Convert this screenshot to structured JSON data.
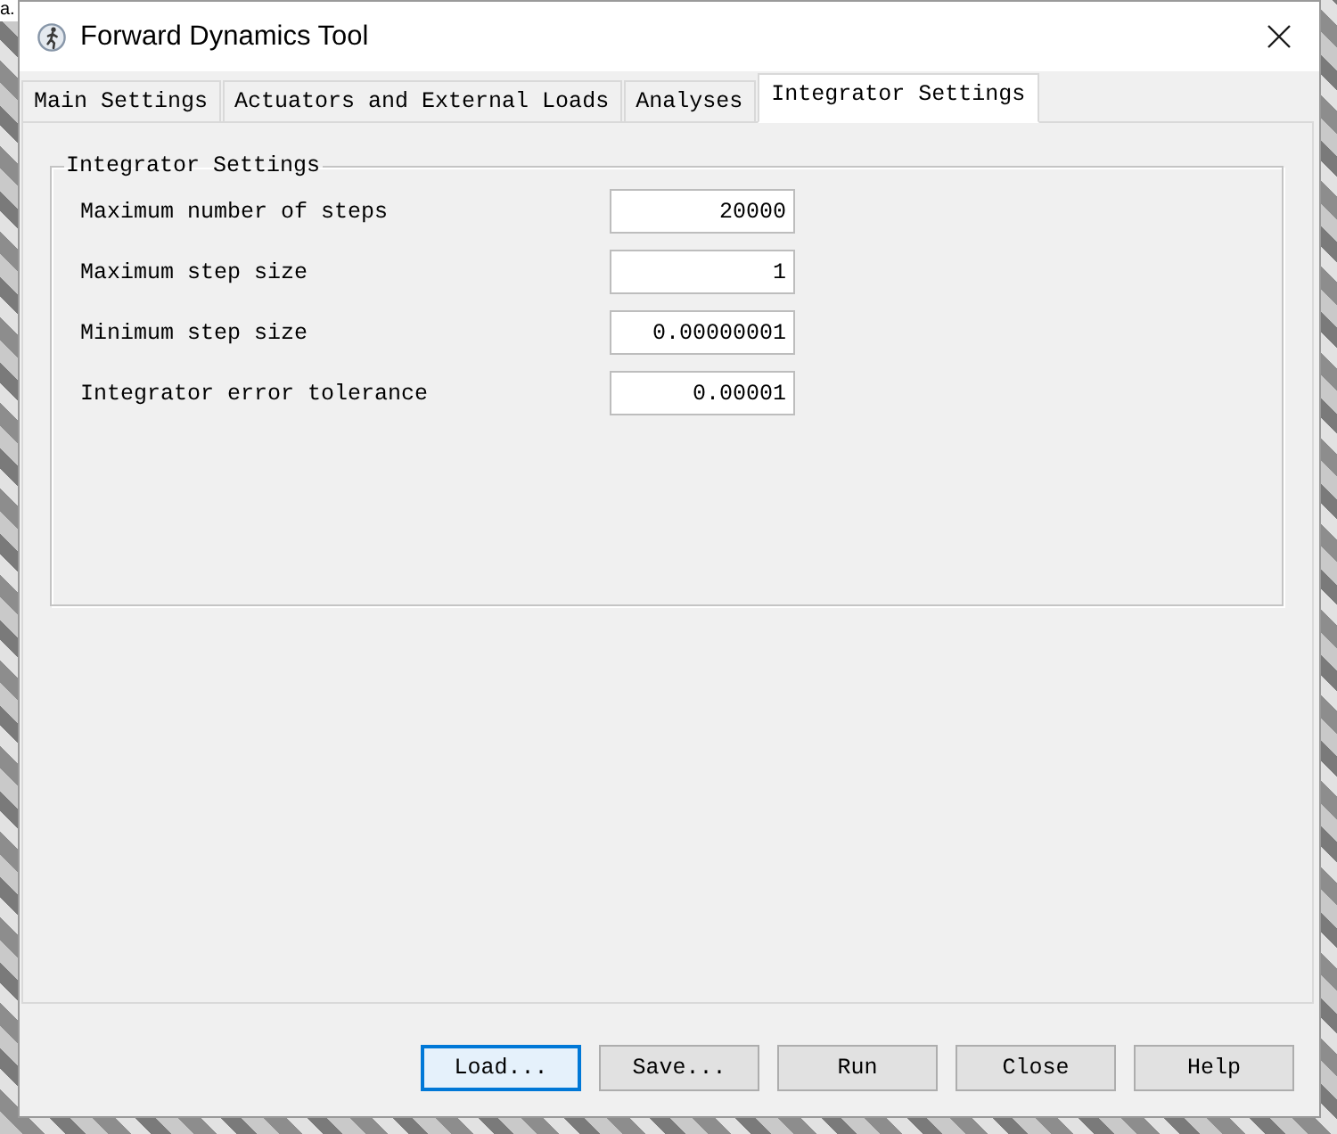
{
  "desktop": {
    "text": "a."
  },
  "window": {
    "title": "Forward Dynamics Tool"
  },
  "tabs": [
    {
      "label": "Main Settings",
      "selected": false
    },
    {
      "label": "Actuators and External Loads",
      "selected": false
    },
    {
      "label": "Analyses",
      "selected": false
    },
    {
      "label": "Integrator Settings",
      "selected": true
    }
  ],
  "group": {
    "title": "Integrator Settings",
    "fields": [
      {
        "label": "Maximum number of steps",
        "value": "20000"
      },
      {
        "label": "Maximum step size",
        "value": "1"
      },
      {
        "label": "Minimum step size",
        "value": "0.00000001"
      },
      {
        "label": "Integrator error tolerance",
        "value": "0.00001"
      }
    ]
  },
  "buttons": [
    {
      "label": "Load...",
      "focused": true
    },
    {
      "label": "Save...",
      "focused": false
    },
    {
      "label": "Run",
      "focused": false
    },
    {
      "label": "Close",
      "focused": false
    },
    {
      "label": "Help",
      "focused": false
    }
  ]
}
